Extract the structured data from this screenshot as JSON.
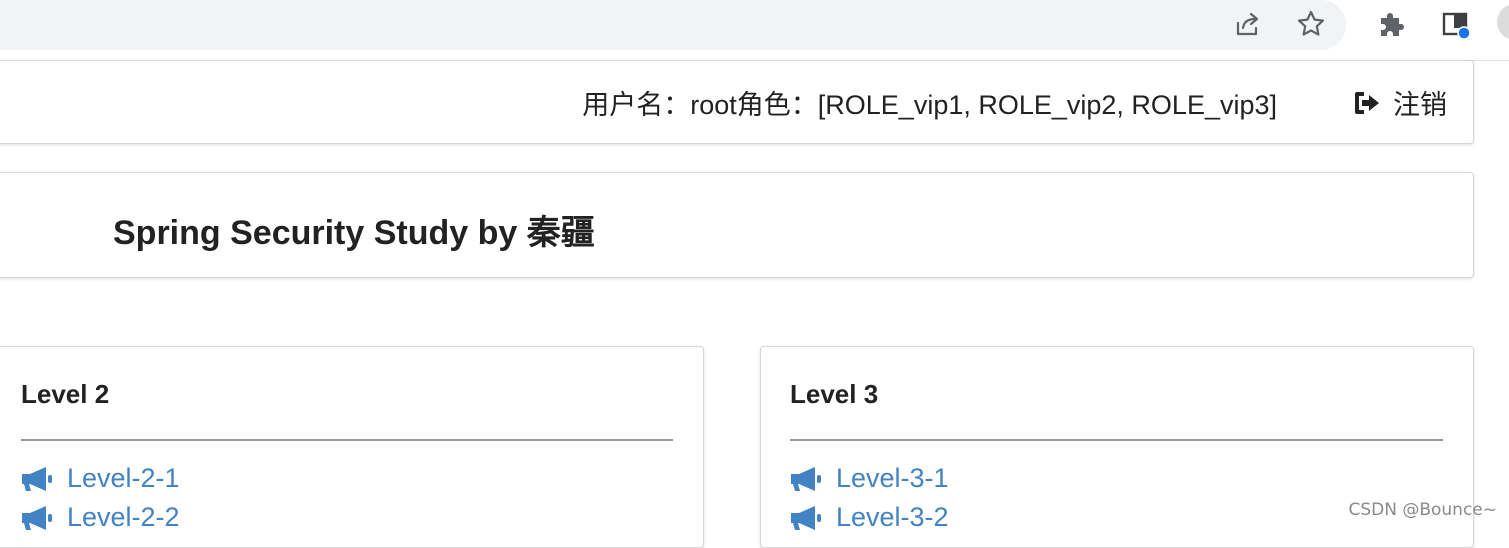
{
  "browser": {
    "icons": {
      "share": "share-icon",
      "bookmark": "star-icon",
      "extensions": "puzzle-icon",
      "side_panel": "side-panel-icon",
      "profile": "profile-avatar"
    }
  },
  "header": {
    "user_info": "用户名：root角色：[ROLE_vip1, ROLE_vip2, ROLE_vip3]",
    "logout_label": "注销",
    "logout_icon": "sign-out-icon"
  },
  "site_title": "Spring Security Study by 秦疆",
  "levels": [
    {
      "title": "Level 2",
      "links": [
        "Level-2-1",
        "Level-2-2"
      ]
    },
    {
      "title": "Level 3",
      "links": [
        "Level-3-1",
        "Level-3-2"
      ]
    }
  ],
  "link_icon": "bullhorn-icon",
  "watermark": "CSDN @Bounce~",
  "colors": {
    "link": "#4183c4",
    "text": "#222222",
    "browser_bar": "#f1f3f4",
    "profile_badge": "#1a73e8"
  }
}
